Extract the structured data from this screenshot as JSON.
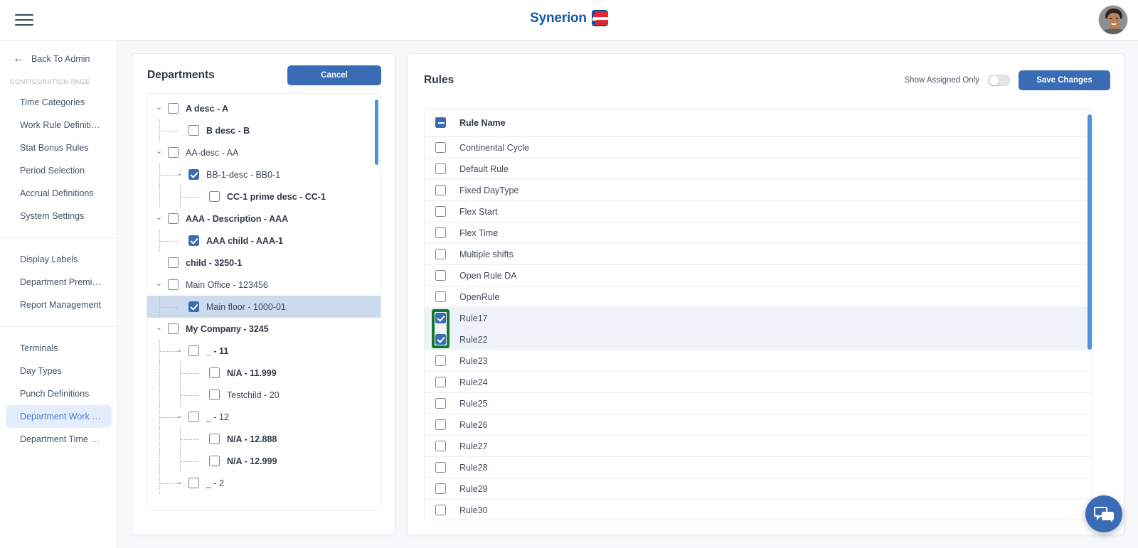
{
  "topbar": {
    "menu_icon": "hamburger-icon",
    "brand_name": "Synerion",
    "avatar_icon": "user-avatar"
  },
  "sidebar": {
    "back_label": "Back To Admin",
    "back_icon": "arrow-left-icon",
    "section_caption": "CONFIGURATION PAGE",
    "group1": [
      {
        "label": "Time Categories",
        "active": false
      },
      {
        "label": "Work Rule Definitions",
        "active": false
      },
      {
        "label": "Stat Bonus Rules",
        "active": false
      },
      {
        "label": "Period Selection",
        "active": false
      },
      {
        "label": "Accrual Definitions",
        "active": false
      },
      {
        "label": "System Settings",
        "active": false
      }
    ],
    "group2": [
      {
        "label": "Display Labels",
        "active": false
      },
      {
        "label": "Department Premiums",
        "active": false
      },
      {
        "label": "Report Management",
        "active": false
      }
    ],
    "group3": [
      {
        "label": "Terminals",
        "active": false
      },
      {
        "label": "Day Types",
        "active": false
      },
      {
        "label": "Punch Definitions",
        "active": false
      },
      {
        "label": "Department Work Rules Filt...",
        "active": true
      },
      {
        "label": "Department Time Category ...",
        "active": false
      }
    ]
  },
  "departments": {
    "title": "Departments",
    "cancel_label": "Cancel",
    "scroll_thumb": "tree-scrollbar",
    "tree": [
      {
        "label": "A desc - A",
        "depth": 0,
        "bold": true,
        "checked": false,
        "caret": "down",
        "selected": false
      },
      {
        "label": "B desc - B",
        "depth": 1,
        "bold": true,
        "checked": false,
        "caret": "none",
        "selected": false
      },
      {
        "label": "AA-desc - AA",
        "depth": 0,
        "bold": false,
        "checked": false,
        "caret": "down",
        "selected": false
      },
      {
        "label": "BB-1-desc - BB0-1",
        "depth": 1,
        "bold": false,
        "checked": true,
        "caret": "down",
        "selected": false
      },
      {
        "label": "CC-1 prime desc - CC-1",
        "depth": 2,
        "bold": true,
        "checked": false,
        "caret": "none",
        "selected": false
      },
      {
        "label": "AAA - Description - AAA",
        "depth": 0,
        "bold": true,
        "checked": false,
        "caret": "down",
        "selected": false
      },
      {
        "label": "AAA child - AAA-1",
        "depth": 1,
        "bold": true,
        "checked": true,
        "caret": "none",
        "selected": false
      },
      {
        "label": "child - 3250-1",
        "depth": 0,
        "bold": true,
        "checked": false,
        "caret": "none",
        "selected": false
      },
      {
        "label": "Main Office - 123456",
        "depth": 0,
        "bold": false,
        "checked": false,
        "caret": "down",
        "selected": false
      },
      {
        "label": "Main floor - 1000-01",
        "depth": 1,
        "bold": false,
        "checked": true,
        "caret": "none",
        "selected": true
      },
      {
        "label": "My Company - 3245",
        "depth": 0,
        "bold": true,
        "checked": false,
        "caret": "down",
        "selected": false
      },
      {
        "label": "_ - 11",
        "depth": 1,
        "bold": true,
        "checked": false,
        "caret": "down",
        "selected": false
      },
      {
        "label": "N/A - 11.999",
        "depth": 2,
        "bold": true,
        "checked": false,
        "caret": "none",
        "selected": false
      },
      {
        "label": "Testchild - 20",
        "depth": 2,
        "bold": false,
        "checked": false,
        "caret": "none",
        "selected": false
      },
      {
        "label": "_ - 12",
        "depth": 1,
        "bold": false,
        "checked": false,
        "caret": "down",
        "selected": false
      },
      {
        "label": "N/A - 12.888",
        "depth": 2,
        "bold": true,
        "checked": false,
        "caret": "none",
        "selected": false
      },
      {
        "label": "N/A - 12.999",
        "depth": 2,
        "bold": true,
        "checked": false,
        "caret": "none",
        "selected": false
      },
      {
        "label": "_ - 2",
        "depth": 1,
        "bold": false,
        "checked": false,
        "caret": "down",
        "selected": false
      }
    ]
  },
  "rules": {
    "title": "Rules",
    "toggle_label": "Show Assigned Only",
    "toggle_on": false,
    "save_label": "Save Changes",
    "column_header": "Rule Name",
    "header_checkbox_state": "indeterminate",
    "scroll_thumb": "rules-scrollbar",
    "items": [
      {
        "label": "Continental Cycle",
        "checked": false
      },
      {
        "label": "Default Rule",
        "checked": false
      },
      {
        "label": "Fixed DayType",
        "checked": false
      },
      {
        "label": "Flex Start",
        "checked": false
      },
      {
        "label": "Flex Time",
        "checked": false
      },
      {
        "label": "Multiple shifts",
        "checked": false
      },
      {
        "label": "Open Rule DA",
        "checked": false
      },
      {
        "label": "OpenRule",
        "checked": false
      },
      {
        "label": "Rule17",
        "checked": true
      },
      {
        "label": "Rule22",
        "checked": true
      },
      {
        "label": "Rule23",
        "checked": false
      },
      {
        "label": "Rule24",
        "checked": false
      },
      {
        "label": "Rule25",
        "checked": false
      },
      {
        "label": "Rule26",
        "checked": false
      },
      {
        "label": "Rule27",
        "checked": false
      },
      {
        "label": "Rule28",
        "checked": false
      },
      {
        "label": "Rule29",
        "checked": false
      },
      {
        "label": "Rule30",
        "checked": false
      }
    ]
  },
  "annotation": {
    "name": "selection-highlight-box",
    "color": "#14782f"
  },
  "chat": {
    "icon": "chat-bubbles-icon"
  },
  "colors": {
    "accent": "#3a6cb5",
    "scrollbar": "#4f93e0",
    "row_selected": "#ccdaee",
    "row_checked": "#eff3f9",
    "nav_active_bg": "#e4edfb",
    "brand_blue": "#1559a8",
    "brand_red": "#e8262d",
    "annotation_green": "#14782f"
  }
}
